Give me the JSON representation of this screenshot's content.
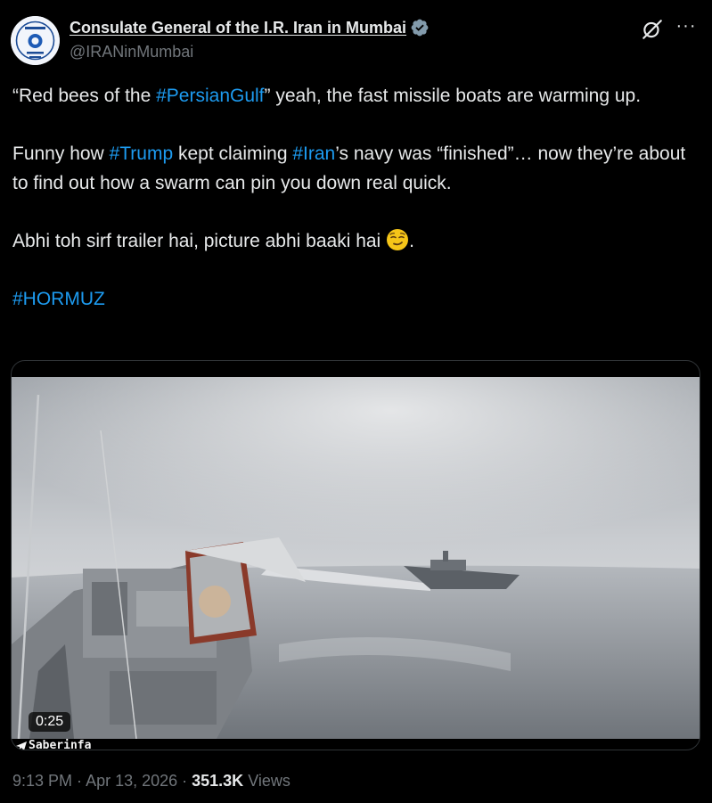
{
  "author": {
    "display_name": "Consulate General of the I.R. Iran in Mumbai",
    "handle": "@IRANinMumbai"
  },
  "tweet": {
    "p1_open_quote": "“Red bees of the ",
    "p1_hashtag": "#PersianGulf",
    "p1_rest": "” yeah, the fast missile boats are warming up.",
    "p2_start": "Funny how ",
    "p2_hashtag1": "#Trump",
    "p2_middle1": " kept claiming ",
    "p2_hashtag2": "#Iran",
    "p2_rest": "’s navy was “finished”… now they’re about to find out how a swarm can pin you down real quick.",
    "p3_text": "Abhi toh sirf trailer hai, picture abhi baaki hai ",
    "p3_end": ".",
    "p4_hashtag": "#HORMUZ"
  },
  "media": {
    "duration": "0:25",
    "watermark": "Saberinfa"
  },
  "meta": {
    "time": "9:13 PM",
    "separator1": " · ",
    "date": "Apr 13, 2026",
    "separator2": " · ",
    "views_count": "351.3K",
    "views_label": " Views"
  },
  "icons": {
    "verified": "verified-badge-icon",
    "grok": "grok-icon",
    "more": "more-options-icon",
    "emoji": "smirking-face-emoji",
    "telegram": "telegram-icon"
  },
  "colors": {
    "background": "#000000",
    "text": "#e7e9ea",
    "secondary_text": "#71767b",
    "link": "#1d9bf0",
    "border": "#2f3336"
  }
}
